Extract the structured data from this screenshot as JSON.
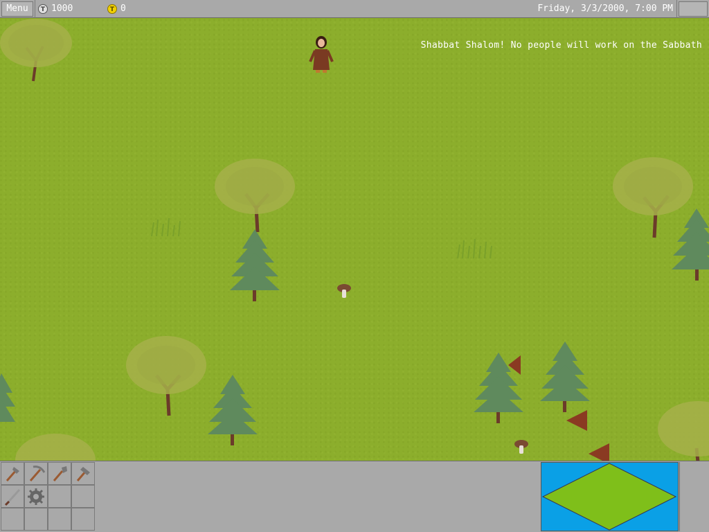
{
  "topbar": {
    "menu_label": "Menu",
    "silver_coins": "1000",
    "gold_coins": "0",
    "coin_glyph": "T",
    "datetime": "Friday, 3/3/2000, 7:00 PM"
  },
  "map": {
    "notice": "Shabbat Shalom! No people will work on the Sabbath"
  },
  "tools": [
    {
      "name": "axe-icon"
    },
    {
      "name": "pickaxe-icon"
    },
    {
      "name": "shovel-icon"
    },
    {
      "name": "hammer-icon"
    },
    {
      "name": "sword-icon"
    },
    {
      "name": "gear-icon"
    },
    {
      "name": "empty-slot"
    },
    {
      "name": "empty-slot"
    },
    {
      "name": "empty-slot"
    },
    {
      "name": "empty-slot"
    },
    {
      "name": "empty-slot"
    },
    {
      "name": "empty-slot"
    }
  ],
  "colors": {
    "grass": "#8cae2c",
    "panel": "#a9a9a9",
    "water": "#0aa0e6",
    "minimap_land": "#7fbf1a"
  }
}
